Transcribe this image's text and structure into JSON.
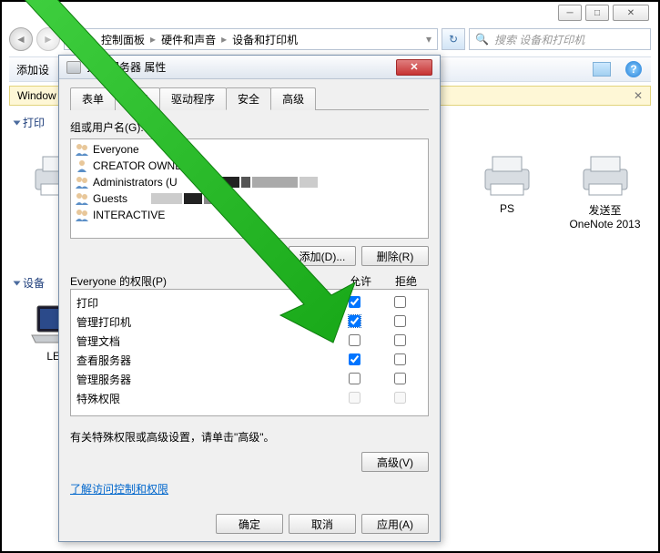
{
  "window": {
    "breadcrumb": {
      "seg1": "控制面板",
      "seg2": "硬件和声音",
      "seg3": "设备和打印机"
    },
    "search_placeholder": "搜索 设备和打印机",
    "toolbar": {
      "add_device": "添加设"
    },
    "infobar": {
      "text": "Window"
    },
    "sections": {
      "printers": "打印",
      "devices": "设备"
    },
    "printers": {
      "p2": "PS",
      "p3": "发送至 OneNote 2013"
    },
    "devices": {
      "d1": "LEN"
    }
  },
  "dialog": {
    "title": "打印服务器 属性",
    "tabs": [
      "表单",
      "端口",
      "驱动程序",
      "安全",
      "高级"
    ],
    "active_tab": 3,
    "group_label": "组或用户名(G):",
    "users": [
      {
        "name": "Everyone"
      },
      {
        "name": "CREATOR OWNER"
      },
      {
        "name": "Administrators (U"
      },
      {
        "name": "Guests"
      },
      {
        "name": "INTERACTIVE"
      }
    ],
    "add_btn": "添加(D)...",
    "remove_btn": "删除(R)",
    "perm_label": "Everyone 的权限(P)",
    "col_allow": "允许",
    "col_deny": "拒绝",
    "permissions": [
      {
        "name": "打印",
        "allow": true,
        "deny": false
      },
      {
        "name": "管理打印机",
        "allow": true,
        "deny": false,
        "highlight": true
      },
      {
        "name": "管理文档",
        "allow": false,
        "deny": false
      },
      {
        "name": "查看服务器",
        "allow": true,
        "deny": false
      },
      {
        "name": "管理服务器",
        "allow": false,
        "deny": false
      },
      {
        "name": "特殊权限",
        "allow": false,
        "deny": false
      }
    ],
    "footer_text": "有关特殊权限或高级设置，请单击\"高级\"。",
    "advanced_btn": "高级(V)",
    "learn_link": "了解访问控制和权限",
    "ok": "确定",
    "cancel": "取消",
    "apply": "应用(A)"
  }
}
